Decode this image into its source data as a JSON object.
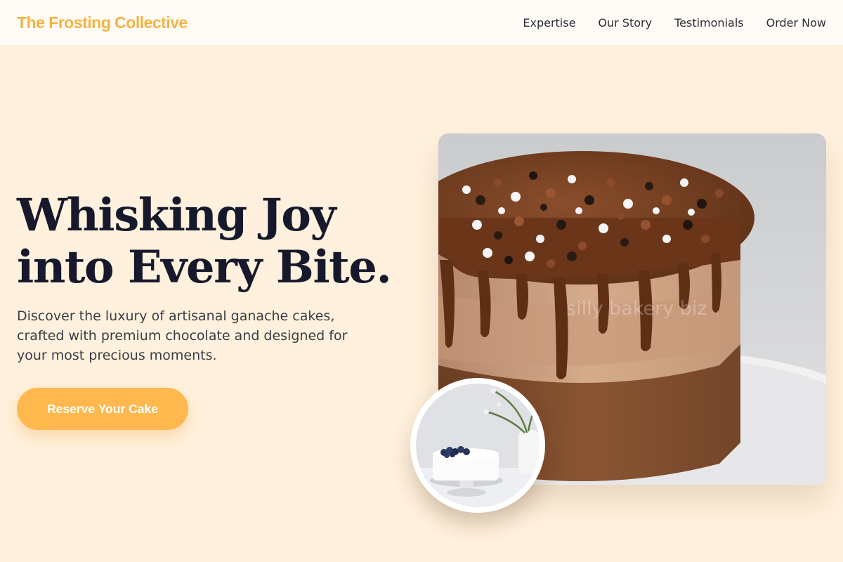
{
  "brand": {
    "name": "The Frosting Collective",
    "color": "#f5b342"
  },
  "nav": {
    "links": [
      "Expertise",
      "Our Story",
      "Testimonials",
      "Order Now"
    ]
  },
  "hero": {
    "headline_line1": "Whisking Joy",
    "headline_line2": "into Every Bite.",
    "headline_color": "#16192b",
    "description": "Discover the luxury of artisanal ganache cakes, crafted with premium chocolate and designed for your most precious moments.",
    "cta_label": "Reserve Your Cake",
    "cta_color": "#ffb84d"
  },
  "images": {
    "main_alt": "Chocolate ganache drip cake with sprinkles",
    "main_watermark": "silly bakery biz",
    "thumb_alt": "White frosted cake with blueberries on a cake stand",
    "main_icon": "cake-photo",
    "thumb_icon": "cake-thumbnail-photo"
  },
  "colors": {
    "page_background": "#fff1dd",
    "navbar_background": "#fffcf8"
  }
}
